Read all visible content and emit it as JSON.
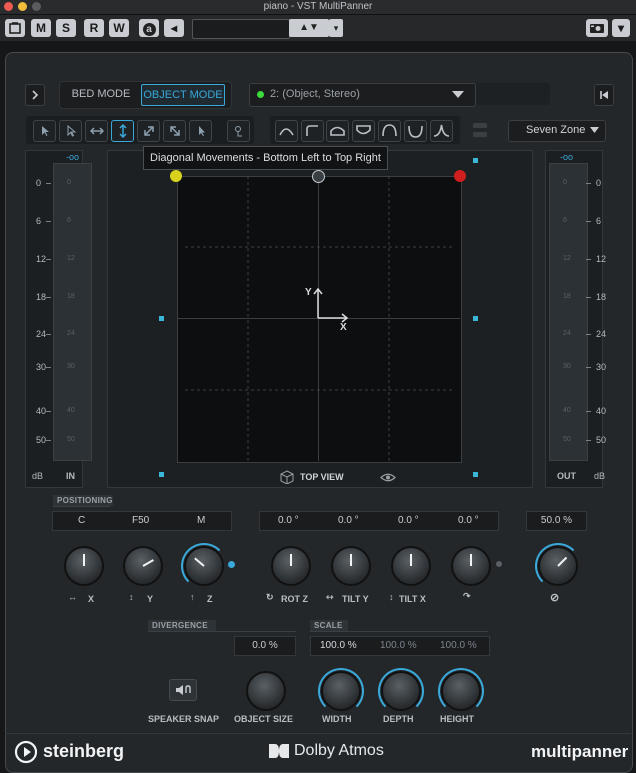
{
  "window": {
    "title": "piano - VST MultiPanner"
  },
  "toolbar": {
    "m": "M",
    "s": "S",
    "r": "R",
    "w": "W",
    "a": "a",
    "back": "◂",
    "updown": "▲▼",
    "drop": "▾"
  },
  "mode": {
    "bed": "BED MODE",
    "object": "OBJECT MODE",
    "active": "object"
  },
  "source": {
    "label": "2: (Object, Stereo)",
    "status_color": "#3ddc3d"
  },
  "zone": {
    "label": "Seven Zone"
  },
  "tooltip": {
    "text": "Diagonal Movements - Bottom Left to Top Right"
  },
  "meters": {
    "in": {
      "peak": "-oo",
      "unit": "dB",
      "label": "IN"
    },
    "out": {
      "peak": "-oo",
      "unit": "dB",
      "label": "OUT"
    },
    "scale": [
      "0",
      "6",
      "12",
      "18",
      "24",
      "30",
      "40",
      "50"
    ]
  },
  "panner": {
    "view_label": "TOP VIEW",
    "axis_x": "X",
    "axis_y": "Y",
    "speaker_colors": {
      "left": "#d8d11e",
      "center": "#3a3f43",
      "right": "#d11e1e"
    }
  },
  "positioning": {
    "header": "POSITIONING",
    "fields": [
      "C",
      "F50",
      "M"
    ],
    "angles": [
      "0.0 °",
      "0.0 °",
      "0.0 °",
      "0.0 °"
    ],
    "size_value": "50.0 %"
  },
  "knobs": {
    "x": "X",
    "y": "Y",
    "z": "Z",
    "rot_z": "ROT Z",
    "tilt_y": "TILT Y",
    "tilt_x": "TILT X"
  },
  "divergence": {
    "header": "DIVERGENCE",
    "value": "0.0 %"
  },
  "scale": {
    "header": "SCALE",
    "values": [
      "100.0 %",
      "100.0 %",
      "100.0 %"
    ]
  },
  "bottom_knobs": {
    "speaker_snap": "SPEAKER SNAP",
    "object_size": "OBJECT SIZE",
    "width": "WIDTH",
    "depth": "DEPTH",
    "height": "HEIGHT"
  },
  "footer": {
    "steinberg": "steinberg",
    "dolby": "Dolby Atmos",
    "product": "multipanner"
  },
  "colors": {
    "accent": "#3aa8d8",
    "background": "#151718",
    "panel": "#23272a"
  }
}
